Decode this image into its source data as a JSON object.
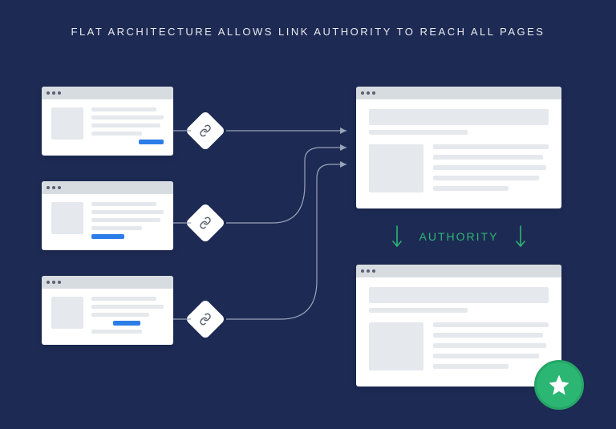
{
  "title": "FLAT ARCHITECTURE ALLOWS LINK AUTHORITY TO REACH ALL PAGES",
  "authority_label": "AUTHORITY",
  "colors": {
    "background": "#1d2a54",
    "accent_green": "#2bb673",
    "accent_blue": "#2b7de9",
    "placeholder_gray": "#e5e8ec",
    "chrome_gray": "#d7dce1"
  },
  "source_pages": [
    {
      "id": 1,
      "has_link_highlight": true
    },
    {
      "id": 2,
      "has_link_highlight": true
    },
    {
      "id": 3,
      "has_link_highlight": true
    }
  ],
  "target_pages": [
    {
      "id": "A",
      "receives_links": true
    },
    {
      "id": "B",
      "receives_authority_from": "A",
      "starred": true
    }
  ],
  "icons": {
    "link": "link-icon",
    "star": "star-icon",
    "arrow_down": "arrow-down-icon"
  }
}
